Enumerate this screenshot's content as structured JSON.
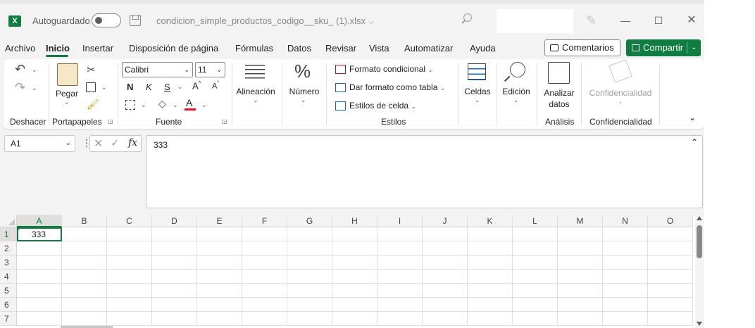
{
  "titlebar": {
    "app_icon": "excel-logo",
    "autosave_label": "Autoguardado",
    "autosave_state": "off",
    "filename": "condicion_simple_productos_codigo__sku_ (1).xlsx",
    "filename_chevron": "⌵",
    "minimize_glyph": "—",
    "maximize_glyph": "☐",
    "close_glyph": "✕"
  },
  "menu": {
    "tabs": [
      "Archivo",
      "Inicio",
      "Insertar",
      "Disposición de página",
      "Fórmulas",
      "Datos",
      "Revisar",
      "Vista",
      "Automatizar",
      "Ayuda"
    ],
    "active_tab": "Inicio",
    "comments_label": "Comentarios",
    "share_label": "Compartir"
  },
  "ribbon": {
    "groups": [
      "Deshacer",
      "Portapapeles",
      "Fuente",
      "Alineación",
      "Número",
      "Estilos",
      "Celdas",
      "Edición",
      "Análisis",
      "Confidencialidad"
    ],
    "paste_label": "Pegar",
    "font_name": "Calibri",
    "font_size": "11",
    "bold": "N",
    "italic": "K",
    "underline": "S",
    "alignment_label": "Alineación",
    "number_label": "Número",
    "number_symbol": "%",
    "conditional_format": "Formato condicional",
    "format_as_table": "Dar formato como tabla",
    "cell_styles": "Estilos de celda",
    "cells_label": "Celdas",
    "editing_label": "Edición",
    "analyze_label_1": "Analizar",
    "analyze_label_2": "datos",
    "confidentiality_label": "Confidencialidad",
    "analysis_group": "Análisis",
    "confidentiality_group": "Confidencialidad",
    "accent_color": "#107c41",
    "font_color_bar": "#e81123"
  },
  "formula_bar": {
    "name_box": "A1",
    "fx": "fx",
    "value": "333"
  },
  "sheet": {
    "columns": [
      "A",
      "B",
      "C",
      "D",
      "E",
      "F",
      "G",
      "H",
      "I",
      "J",
      "K",
      "L",
      "M",
      "N",
      "O"
    ],
    "rows": [
      "1",
      "2",
      "3",
      "4",
      "5",
      "6",
      "7"
    ],
    "selected_cell": "A1",
    "cells": {
      "A1": "333"
    }
  }
}
